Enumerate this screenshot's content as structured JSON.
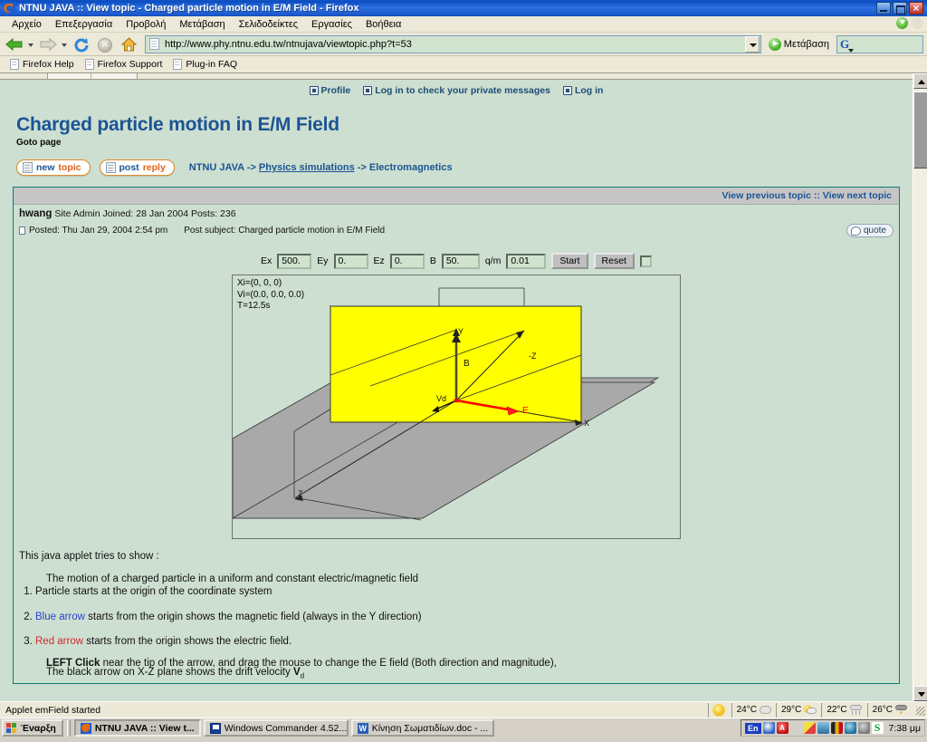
{
  "window": {
    "title": "NTNU JAVA :: View topic - Charged particle motion in E/M Field - Firefox",
    "icon": "firefox-icon",
    "minimize": "_",
    "maximize": "□",
    "close": "×"
  },
  "menu": {
    "items": [
      {
        "label": "Αρχείο"
      },
      {
        "label": "Επεξεργασία"
      },
      {
        "label": "Προβολή"
      },
      {
        "label": "Μετάβαση"
      },
      {
        "label": "Σελιδοδείκτες"
      },
      {
        "label": "Εργασίες"
      },
      {
        "label": "Βοήθεια"
      }
    ]
  },
  "toolbar": {
    "back": "Back",
    "forward": "Forward",
    "reload": "Reload",
    "stop": "Stop",
    "home": "Home",
    "url": "http://www.phy.ntnu.edu.tw/ntnujava/viewtopic.php?t=53",
    "url_placeholder": "",
    "go_label": "Μετάβαση",
    "search_value": "",
    "search_placeholder": ""
  },
  "bookmarks": {
    "items": [
      {
        "label": "Firefox Help"
      },
      {
        "label": "Firefox Support"
      },
      {
        "label": "Plug-in FAQ"
      }
    ]
  },
  "forum": {
    "toplinks": [
      {
        "label": "Profile",
        "icon": "profile-icon"
      },
      {
        "label": "Log in to check your private messages",
        "icon": "envelope-icon"
      },
      {
        "label": "Log in",
        "icon": "login-icon"
      }
    ],
    "topic_title": "Charged particle motion in E/M Field",
    "goto_page": "Goto page",
    "new_topic_a": "new",
    "new_topic_b": "topic",
    "post_reply_a": "post",
    "post_reply_b": "reply",
    "breadcrumb": {
      "root": "NTNU JAVA",
      "sep": " -> ",
      "level1": "Physics simulations",
      "level2": "Electromagnetics"
    },
    "view_prev": "View previous topic",
    "view_sep": " :: ",
    "view_next": "View next topic",
    "author": "hwang",
    "author_meta": "Site Admin Joined: 28 Jan 2004 Posts: 236",
    "posted": "Posted: Thu Jan 29, 2004 2:54 pm",
    "post_subject": "Post subject: Charged particle motion in E/M Field",
    "quote_label": "quote"
  },
  "applet": {
    "fields": [
      {
        "label": "Ex",
        "value": "500."
      },
      {
        "label": "Ey",
        "value": "0."
      },
      {
        "label": "Ez",
        "value": "0."
      },
      {
        "label": "B",
        "value": "50."
      },
      {
        "label": "q/m",
        "value": "0.01"
      }
    ],
    "start_label": "Start",
    "reset_label": "Reset",
    "checkbox_checked": false,
    "info": {
      "xi": "Xi=(0, 0, 0)",
      "vi": "Vi=(0.0, 0.0, 0.0)",
      "t": "T=12.5s"
    },
    "axis_labels": {
      "y": "Y",
      "x": "X",
      "z": "Z",
      "negz": "-Z",
      "b": "B",
      "e": "E",
      "vd": "Vd"
    },
    "colors": {
      "plane_field": "#ffff00",
      "plane_ground": "#a9a9a9",
      "e_arrow": "#ff0000",
      "b_arrow": "#555555",
      "canvas_bg": "#cddfd0"
    }
  },
  "description": {
    "lead": "This java applet tries to show :",
    "sub": "The motion of a charged particle in a uniform and constant electric/magnetic field",
    "item1": "Particle starts at the origin of the coordinate system",
    "item2_link": "Blue arrow",
    "item2_rest": " starts from the origin shows the magnetic field (always in the Y direction)",
    "item3_link": "Red arrow",
    "item3_rest": " starts from the origin shows the electric field.",
    "para4_bold": "LEFT Click",
    "para4_rest": " near the tip of the arrow, and drag the mouse to change the E field (Both direction and magnitude),",
    "para5_a": "The black arrow on X-Z plane shows the drift velocity ",
    "para5_b": "V",
    "para5_sub": "d"
  },
  "statusbar": {
    "text": "Applet emField started",
    "weather": [
      {
        "temp": "",
        "icon": "sun-icon"
      },
      {
        "temp": "24°C",
        "icon": "cloud-icon"
      },
      {
        "temp": "29°C",
        "icon": "sun-cloud-icon"
      },
      {
        "temp": "22°C",
        "icon": "rain-icon"
      },
      {
        "temp": "26°C",
        "icon": "storm-icon"
      }
    ]
  },
  "taskbar": {
    "start_label": "Έναρξη",
    "tasks": [
      {
        "label": "NTNU JAVA :: View t...",
        "icon": "firefox-icon",
        "active": true
      },
      {
        "label": "Windows Commander 4.52...",
        "icon": "commander-icon",
        "active": false
      },
      {
        "label": "Κίνηση Σωματιδίων.doc - ...",
        "icon": "word-icon",
        "active": false
      }
    ],
    "tray": {
      "lang": "En",
      "time": "7:38 μμ"
    }
  }
}
